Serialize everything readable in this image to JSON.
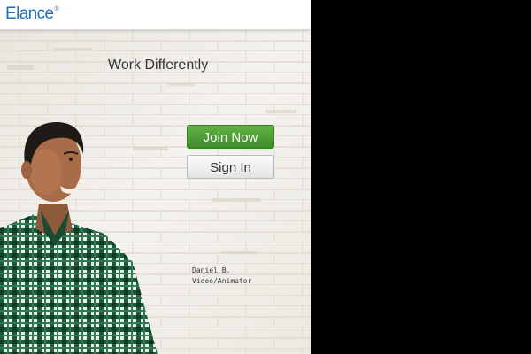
{
  "header": {
    "logo_text": "Elance",
    "logo_mark": "®"
  },
  "hero": {
    "tagline": "Work Differently",
    "person_name": "Daniel B.",
    "person_role": "Video/Animator"
  },
  "actions": {
    "join_label": "Join Now",
    "signin_label": "Sign In"
  },
  "colors": {
    "brand_blue": "#1b6fc2",
    "join_green": "#4e9f36",
    "wall": "#f1efe9",
    "outside": "#000000"
  }
}
